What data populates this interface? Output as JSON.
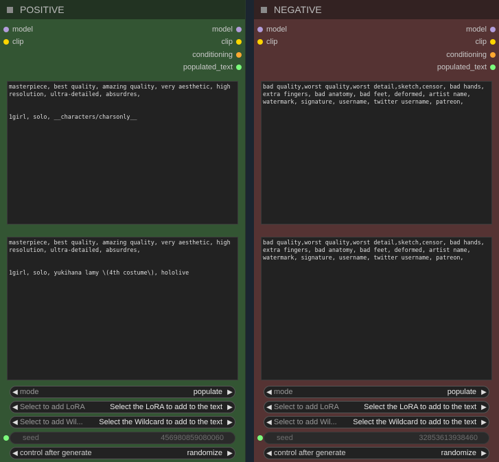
{
  "positive": {
    "title": "POSITIVE",
    "inputs": [
      "model",
      "clip"
    ],
    "outputs": [
      "model",
      "clip",
      "conditioning",
      "populated_text"
    ],
    "wildcard_text": "masterpiece, best quality, amazing quality, very aesthetic, high resolution, ultra-detailed, absurdres,\n\n\n1girl, solo, __characters/charsonly__",
    "populated_text": "masterpiece, best quality, amazing quality, very aesthetic, high resolution, ultra-detailed, absurdres,\n\n\n1girl, solo, yukihana lamy \\(4th costume\\), hololive",
    "widgets": {
      "mode_label": "mode",
      "mode_value": "populate",
      "lora_label": "Select to add LoRA",
      "lora_value": "Select the LoRA to add to the text",
      "wildcard_label": "Select to add Wil...",
      "wildcard_value": "Select the Wildcard to add to the text",
      "seed_label": "seed",
      "seed_value": "456980859080060",
      "control_label": "control after generate",
      "control_value": "randomize"
    }
  },
  "negative": {
    "title": "NEGATIVE",
    "inputs": [
      "model",
      "clip"
    ],
    "outputs": [
      "model",
      "clip",
      "conditioning",
      "populated_text"
    ],
    "wildcard_text": "bad quality,worst quality,worst detail,sketch,censor, bad hands, extra fingers, bad anatomy, bad feet, deformed, artist name, watermark, signature, username, twitter username, patreon,",
    "populated_text": "bad quality,worst quality,worst detail,sketch,censor, bad hands, extra fingers, bad anatomy, bad feet, deformed, artist name, watermark, signature, username, twitter username, patreon,",
    "widgets": {
      "mode_label": "mode",
      "mode_value": "populate",
      "lora_label": "Select to add LoRA",
      "lora_value": "Select the LoRA to add to the text",
      "wildcard_label": "Select to add Wil...",
      "wildcard_value": "Select the Wildcard to add to the text",
      "seed_label": "seed",
      "seed_value": "32853613938460",
      "control_label": "control after generate",
      "control_value": "randomize"
    }
  },
  "colors": {
    "model": "#b39ddb",
    "clip": "#ffd500",
    "conditioning": "#ffa931",
    "populated_text": "#7cfc7c",
    "positive_body": "#335533",
    "negative_body": "#553333"
  },
  "icons": {
    "left_arrow": "◀",
    "right_arrow": "▶",
    "title_marker": "■"
  }
}
